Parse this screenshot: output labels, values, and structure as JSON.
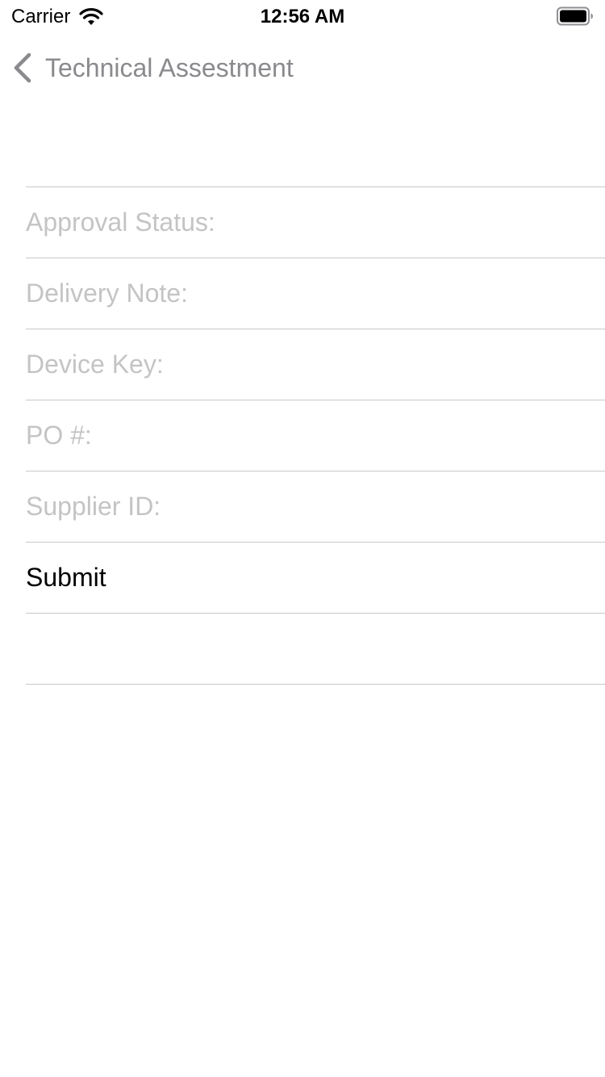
{
  "status_bar": {
    "carrier": "Carrier",
    "time": "12:56 AM",
    "wifi_icon": "wifi-icon",
    "battery_icon": "battery-icon"
  },
  "nav": {
    "back_icon": "chevron-left-icon",
    "back_title": "Technical Assestment"
  },
  "form": {
    "fields": [
      {
        "placeholder": "Approval Status:",
        "value": ""
      },
      {
        "placeholder": "Delivery Note:",
        "value": ""
      },
      {
        "placeholder": "Device Key:",
        "value": ""
      },
      {
        "placeholder": "PO #:",
        "value": ""
      },
      {
        "placeholder": "Supplier ID:",
        "value": ""
      }
    ],
    "submit_label": "Submit"
  },
  "colors": {
    "placeholder": "#c4c4c6",
    "separator": "#c8c7cc",
    "nav_title": "#8a8a8e",
    "text": "#000000",
    "background": "#ffffff"
  }
}
